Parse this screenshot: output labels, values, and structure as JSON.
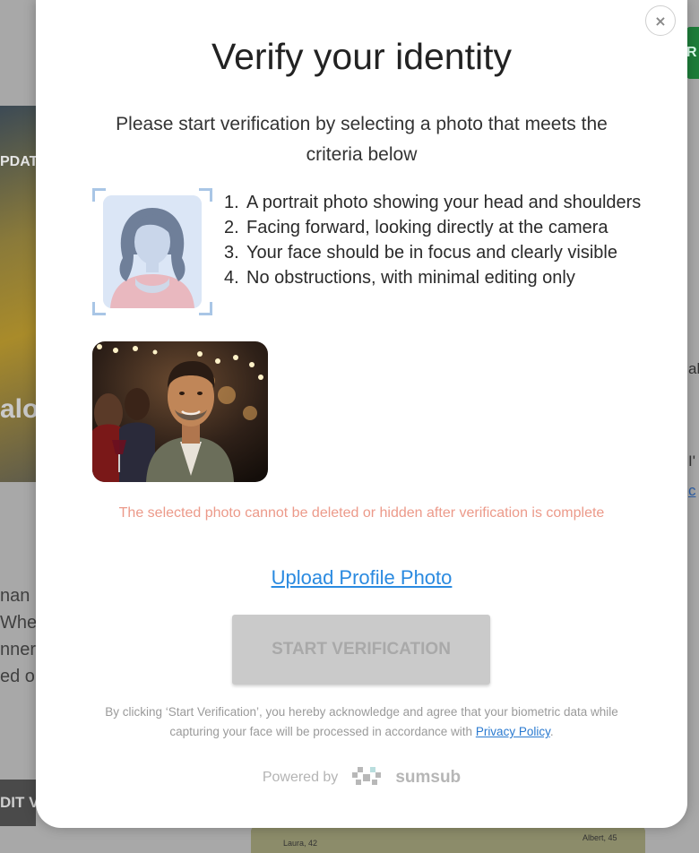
{
  "modal": {
    "close_label": "×",
    "title": "Verify your identity",
    "subtitle": "Please start verification by selecting a photo that meets the criteria below",
    "criteria": [
      {
        "num": "1.",
        "text": "A portrait photo showing your head and shoulders"
      },
      {
        "num": "2.",
        "text": "Facing forward, looking directly at the camera"
      },
      {
        "num": "3.",
        "text": "Your face should be in focus and clearly visible"
      },
      {
        "num": "4.",
        "text": "No obstructions, with minimal editing only"
      }
    ],
    "warning": "The selected photo cannot be deleted or hidden after verification is complete",
    "upload_link": "Upload Profile Photo",
    "start_button": "START VERIFICATION",
    "legal_prefix": "By clicking ‘Start Verification’, you hereby acknowledge and agree that your biometric data while capturing your face will be processed in accordance with ",
    "legal_link": "Privacy Policy",
    "legal_suffix": ".",
    "powered_by": "Powered by",
    "brand": "sumsub"
  },
  "background": {
    "hero_badge": "PDAT",
    "hero_word": "alo",
    "left_text": [
      "nan",
      "Whet",
      "nner",
      "ed o"
    ],
    "left_button": "DIT V",
    "right_button": "R",
    "right_text_1": "al",
    "right_text_2": "I'",
    "right_link": "c",
    "thumb_label_1": "Laura, 42",
    "thumb_label_2": "Albert, 45"
  },
  "colors": {
    "warning": "#ec9a8a",
    "link": "#2a8ae0",
    "button_disabled_bg": "#cacaca",
    "button_disabled_text": "#a9a9a9",
    "frame_corner": "#a9c6e6"
  },
  "icons": {
    "close": "close-icon",
    "portrait": "portrait-placeholder-icon",
    "brand": "sumsub-logo-icon"
  }
}
